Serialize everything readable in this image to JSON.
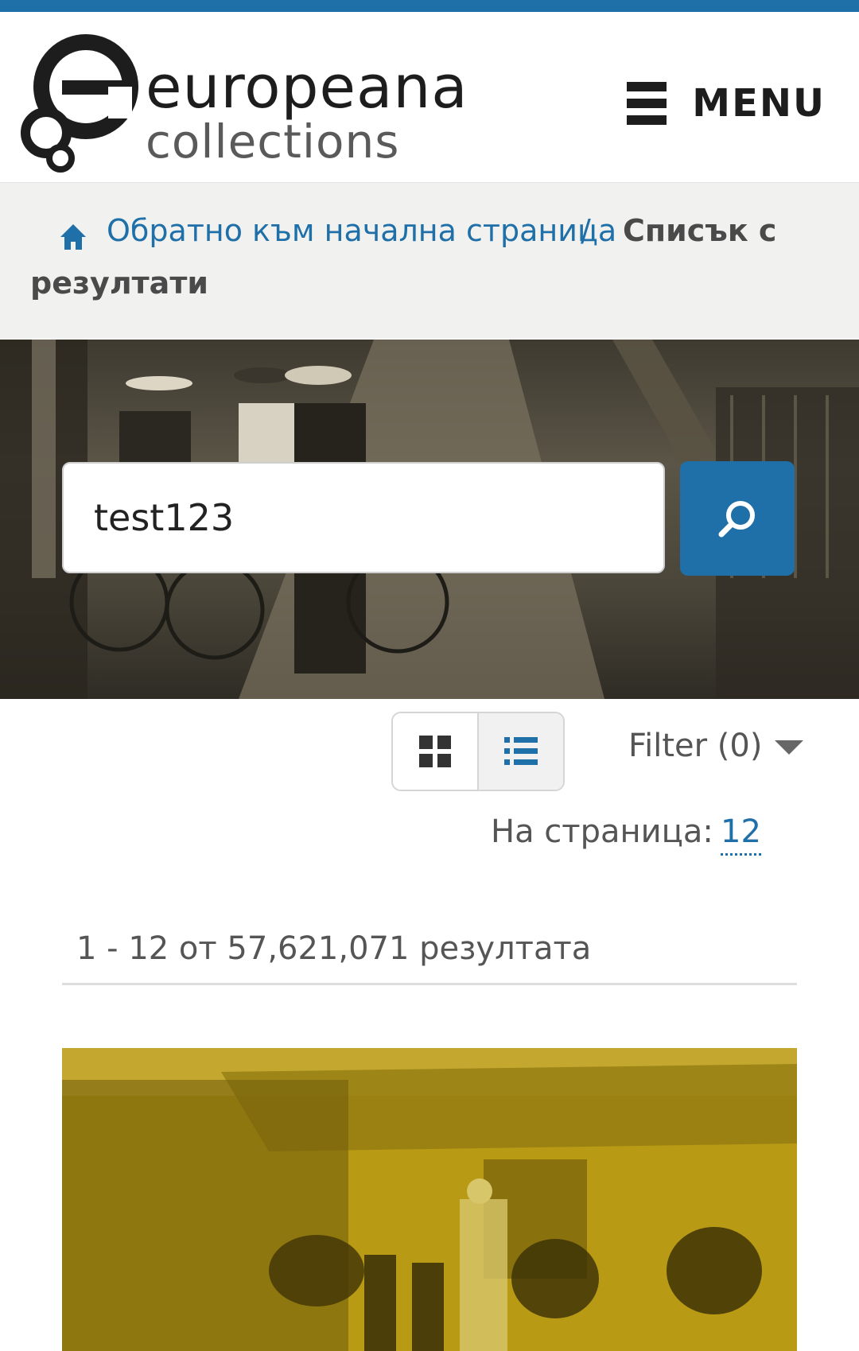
{
  "header": {
    "logo_line1": "europeana",
    "logo_line2": "collections",
    "menu_label": "MENU"
  },
  "breadcrumb": {
    "home_label": "Обратно към начална страница",
    "separator": "/",
    "current_line1": "Списък с",
    "current_line2": "резултати"
  },
  "search": {
    "query": "test123"
  },
  "toolbar": {
    "filter_label": "Filter (0)",
    "per_page_label": "На страница:",
    "per_page_value": "12"
  },
  "results": {
    "count_text": "1 - 12 от 57,621,071 резултата"
  },
  "icons": {
    "home": "home-icon",
    "search": "search-icon",
    "grid": "grid-view-icon",
    "list": "list-view-icon",
    "menu": "hamburger-icon"
  },
  "colors": {
    "brand_blue": "#1f6fa8",
    "breadcrumb_bg": "#f1f1ef",
    "result_tint": "#b89a15"
  }
}
